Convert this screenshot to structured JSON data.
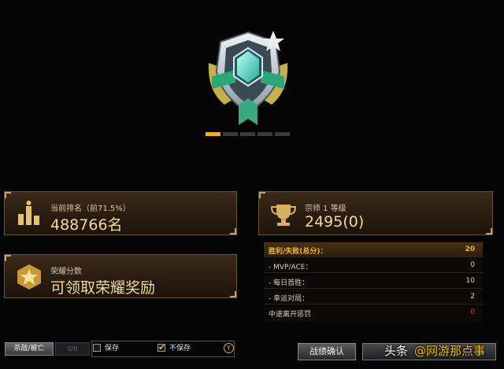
{
  "progress": {
    "filled": 1,
    "total": 5
  },
  "rank": {
    "label": "当前排名（前71.5%）",
    "value": "488766名"
  },
  "honor": {
    "label": "荣耀分数",
    "value": "可领取荣耀奖励"
  },
  "tier": {
    "label": "宗师 1 等级",
    "value": "2495(0)"
  },
  "stats": {
    "rows": [
      {
        "label": "胜利/失败(总分)：",
        "value": "20"
      },
      {
        "label": "- MVP/ACE：",
        "value": "0"
      },
      {
        "label": "- 每日首胜：",
        "value": "10"
      },
      {
        "label": "- 幸运对局：",
        "value": "2"
      },
      {
        "label": "中途离开惩罚",
        "value": "0"
      }
    ]
  },
  "bottom": {
    "kd_label": "杀敌/被亡",
    "kd_value": "0/0",
    "save_label": "保存",
    "nosave_label": "不保存",
    "circle_icon_text": "Y",
    "confirm_label": "战绩确认"
  },
  "watermark": {
    "brand": "头条",
    "author": "@网游那点事"
  },
  "colors": {
    "accent": "#f0b020",
    "panel": "#3b2a17",
    "penalty": "#e83030"
  }
}
